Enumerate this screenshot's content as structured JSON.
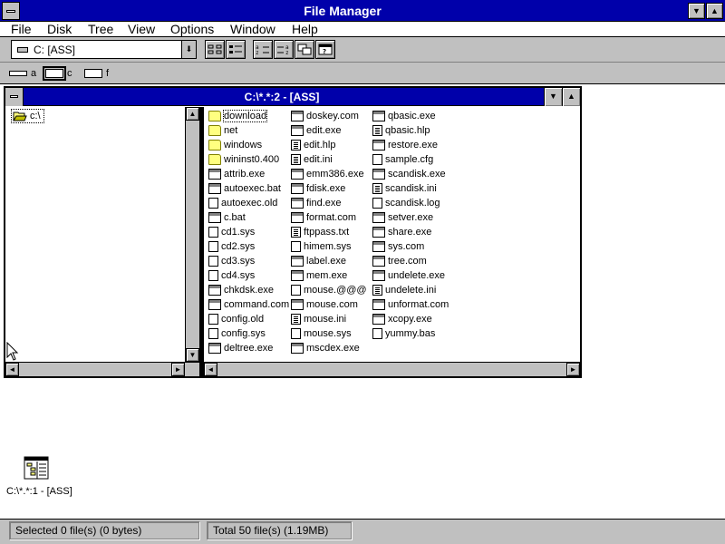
{
  "window": {
    "title": "File Manager",
    "min_glyph": "▼",
    "max_glyph": "▲"
  },
  "menu": [
    "File",
    "Disk",
    "Tree",
    "View",
    "Options",
    "Window",
    "Help"
  ],
  "toolbar": {
    "drive_value": "C: [ASS]",
    "arrow_glyph": "⬇"
  },
  "drives": [
    {
      "letter": "a",
      "selected": false
    },
    {
      "letter": "c",
      "selected": true
    },
    {
      "letter": "f",
      "selected": false
    }
  ],
  "child_window": {
    "title": "C:\\*.*:2 - [ASS]",
    "min_glyph": "▼",
    "max_glyph": "▲"
  },
  "tree": {
    "root": "c:\\"
  },
  "scroll": {
    "up": "▲",
    "down": "▼",
    "left": "◄",
    "right": "►"
  },
  "files": [
    {
      "name": "download",
      "type": "folder"
    },
    {
      "name": "net",
      "type": "folder"
    },
    {
      "name": "windows",
      "type": "folder"
    },
    {
      "name": "wininst0.400",
      "type": "folder"
    },
    {
      "name": "attrib.exe",
      "type": "exe"
    },
    {
      "name": "autoexec.bat",
      "type": "exe"
    },
    {
      "name": "autoexec.old",
      "type": "sys"
    },
    {
      "name": "c.bat",
      "type": "exe"
    },
    {
      "name": "cd1.sys",
      "type": "sys"
    },
    {
      "name": "cd2.sys",
      "type": "sys"
    },
    {
      "name": "cd3.sys",
      "type": "sys"
    },
    {
      "name": "cd4.sys",
      "type": "sys"
    },
    {
      "name": "chkdsk.exe",
      "type": "exe"
    },
    {
      "name": "command.com",
      "type": "exe"
    },
    {
      "name": "config.old",
      "type": "sys"
    },
    {
      "name": "config.sys",
      "type": "sys"
    },
    {
      "name": "deltree.exe",
      "type": "exe"
    },
    {
      "name": "doskey.com",
      "type": "exe"
    },
    {
      "name": "edit.exe",
      "type": "exe"
    },
    {
      "name": "edit.hlp",
      "type": "doc"
    },
    {
      "name": "edit.ini",
      "type": "doc"
    },
    {
      "name": "emm386.exe",
      "type": "exe"
    },
    {
      "name": "fdisk.exe",
      "type": "exe"
    },
    {
      "name": "find.exe",
      "type": "exe"
    },
    {
      "name": "format.com",
      "type": "exe"
    },
    {
      "name": "ftppass.txt",
      "type": "doc"
    },
    {
      "name": "himem.sys",
      "type": "sys"
    },
    {
      "name": "label.exe",
      "type": "exe"
    },
    {
      "name": "mem.exe",
      "type": "exe"
    },
    {
      "name": "mouse.@@@",
      "type": "sys"
    },
    {
      "name": "mouse.com",
      "type": "exe"
    },
    {
      "name": "mouse.ini",
      "type": "doc"
    },
    {
      "name": "mouse.sys",
      "type": "sys"
    },
    {
      "name": "mscdex.exe",
      "type": "exe"
    },
    {
      "name": "qbasic.exe",
      "type": "exe"
    },
    {
      "name": "qbasic.hlp",
      "type": "doc"
    },
    {
      "name": "restore.exe",
      "type": "exe"
    },
    {
      "name": "sample.cfg",
      "type": "sys"
    },
    {
      "name": "scandisk.exe",
      "type": "exe"
    },
    {
      "name": "scandisk.ini",
      "type": "doc"
    },
    {
      "name": "scandisk.log",
      "type": "sys"
    },
    {
      "name": "setver.exe",
      "type": "exe"
    },
    {
      "name": "share.exe",
      "type": "exe"
    },
    {
      "name": "sys.com",
      "type": "exe"
    },
    {
      "name": "tree.com",
      "type": "exe"
    },
    {
      "name": "undelete.exe",
      "type": "exe"
    },
    {
      "name": "undelete.ini",
      "type": "doc"
    },
    {
      "name": "unformat.com",
      "type": "exe"
    },
    {
      "name": "xcopy.exe",
      "type": "exe"
    },
    {
      "name": "yummy.bas",
      "type": "sys"
    }
  ],
  "minimized": {
    "label": "C:\\*.*:1 - [ASS]"
  },
  "status": {
    "selected": "Selected 0 file(s) (0 bytes)",
    "total": "Total 50 file(s) (1.19MB)"
  }
}
